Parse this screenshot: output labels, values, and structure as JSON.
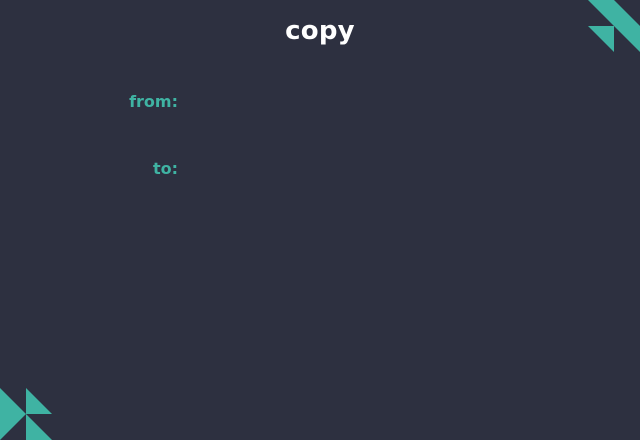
{
  "page": {
    "title": "copy"
  },
  "form": {
    "from_label": "from:",
    "to_label": "to:",
    "from_value": "",
    "to_value": ""
  },
  "theme": {
    "background": "#2d3040",
    "accent": "#3fb3a3",
    "title_color": "#ffffff"
  },
  "decorations": {
    "top_right_icon": "triangle-pattern-icon",
    "bottom_left_icon": "triangle-pattern-icon"
  }
}
